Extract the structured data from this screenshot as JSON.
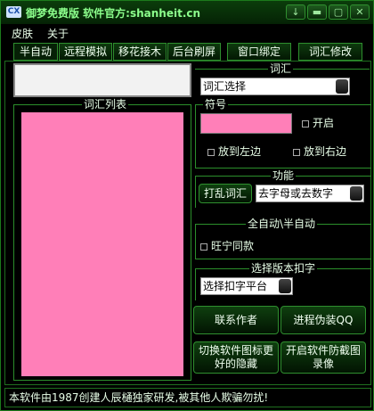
{
  "app": {
    "title": "御梦免费版  软件官方:shanheit.cn",
    "logo_text": "CX"
  },
  "window_buttons": [
    {
      "label": "↓"
    },
    {
      "label": "▬"
    },
    {
      "label": "▢"
    },
    {
      "label": "✕"
    }
  ],
  "menu": [
    "皮肤",
    "关于"
  ],
  "tabs": [
    "半自动",
    "远程模拟",
    "移花接木",
    "后台刷屏",
    "窗口绑定",
    "词汇修改"
  ],
  "left": {
    "word_list_legend": "词汇列表",
    "list_color": "#ff7fb8",
    "input_value": ""
  },
  "vocab": {
    "legend": "词汇",
    "combo_value": "词汇选择"
  },
  "symbol": {
    "legend": "符号",
    "open_label": "开启",
    "left_label": "放到左边",
    "right_label": "放到右边",
    "swatch_color": "#ff7fb8"
  },
  "function": {
    "legend": "功能",
    "shuffle_button": "打乱词汇",
    "combo_value": "去字母或去数字"
  },
  "auto": {
    "legend": "全自动\\半自动",
    "wangning_label": "旺宁同款"
  },
  "version": {
    "legend": "选择版本扣字",
    "combo_value": "选择扣字平台"
  },
  "buttons": {
    "contact": "联系作者",
    "disguise": "进程伪装QQ",
    "icon_line1": "切换软件图标更",
    "icon_line2": "好的隐藏",
    "anti_line1": "开启软件防截图",
    "anti_line2": "录像"
  },
  "status": {
    "text": "本软件由1987创建人辰樋独家研发,被其他人欺骗勿扰!"
  },
  "colors": {
    "accent_green": "#2e8e2e",
    "pink": "#ff7fb8"
  }
}
